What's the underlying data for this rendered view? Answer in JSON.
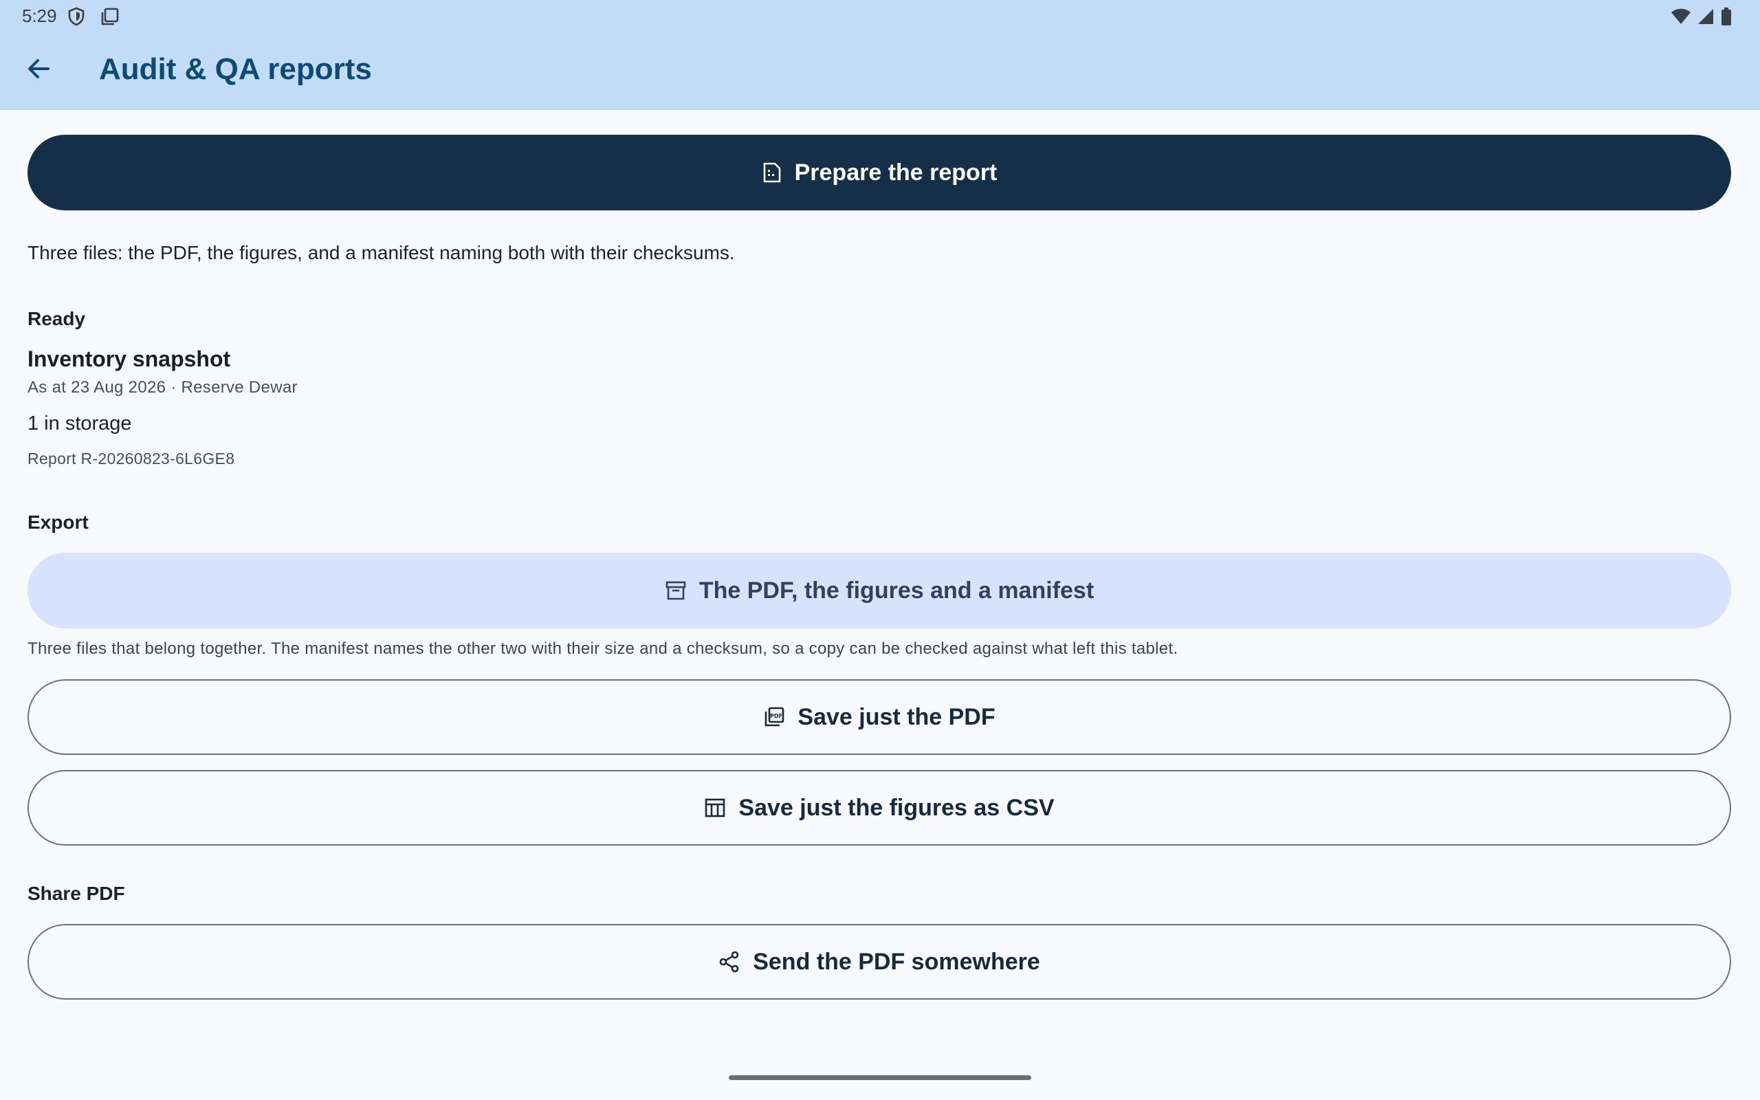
{
  "status_bar": {
    "time": "5:29",
    "left_icons": [
      "shield-icon",
      "screen-icon"
    ],
    "right_icons": [
      "wifi-icon",
      "signal-icon",
      "battery-icon"
    ]
  },
  "app_bar": {
    "title": "Audit & QA reports",
    "back_icon": "arrow-back-icon",
    "background": "#c2dbf6",
    "title_color": "#0d4a75"
  },
  "prepare": {
    "label": "Prepare the report",
    "icon": "document-icon",
    "background": "#152f48",
    "description": "Three files: the PDF, the figures, and a manifest naming both with their checksums."
  },
  "ready": {
    "heading": "Ready",
    "title": "Inventory snapshot",
    "subtitle": "As at 23 Aug 2026 · Reserve Dewar",
    "count": "1 in storage",
    "report_id": "Report R-20260823-6L6GE8"
  },
  "export": {
    "heading": "Export",
    "bundle_label": "The PDF, the figures and a manifest",
    "bundle_icon": "archive-icon",
    "bundle_help": "Three files that belong together. The manifest names the other two with their size and a checksum, so a copy can be checked against what left this tablet.",
    "pdf_label": "Save just the PDF",
    "pdf_icon": "pdf-icon",
    "csv_label": "Save just the figures as CSV",
    "csv_icon": "table-icon"
  },
  "share": {
    "heading": "Share PDF",
    "label": "Send the PDF somewhere",
    "icon": "share-icon"
  }
}
